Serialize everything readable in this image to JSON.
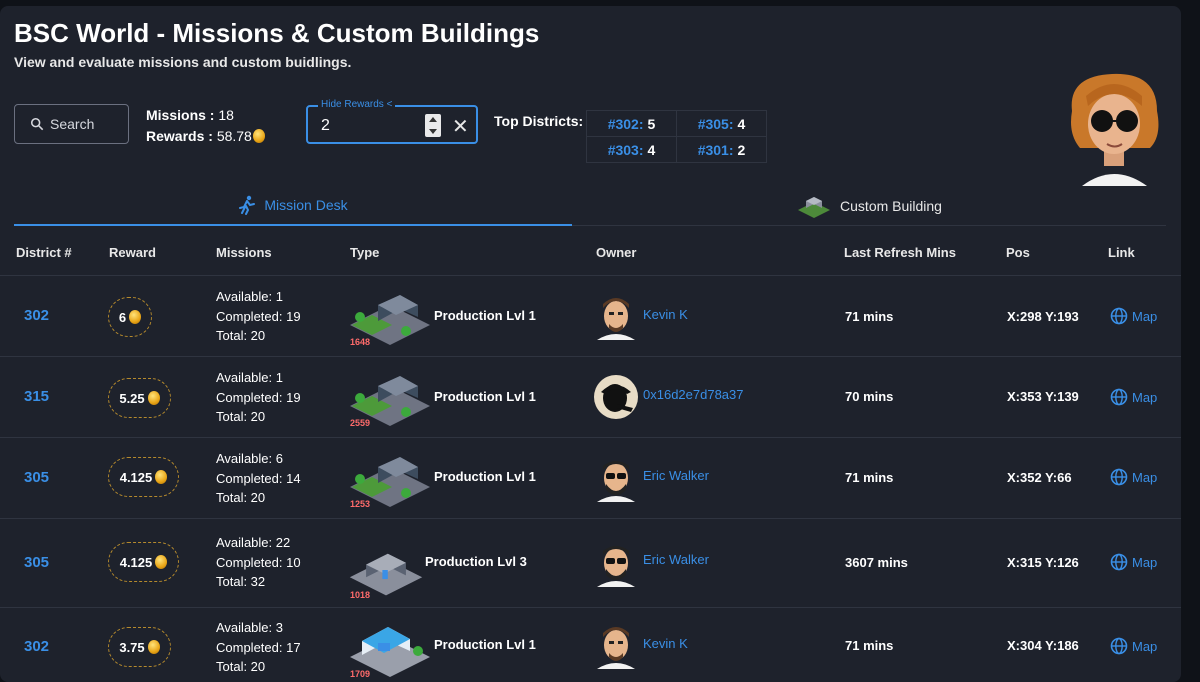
{
  "header": {
    "title": "BSC World - Missions & Custom Buildings",
    "subtitle": "View and evaluate missions and custom buidlings."
  },
  "toolbar": {
    "search_label": "Search",
    "missions_label": "Missions :",
    "missions_value": "18",
    "rewards_label": "Rewards :",
    "rewards_value": "58.78",
    "hide_rewards_label": "Hide Rewards <",
    "hide_rewards_value": "2",
    "top_districts_label": "Top Districts:"
  },
  "top_districts": [
    {
      "district": "#302:",
      "count": "5"
    },
    {
      "district": "#305:",
      "count": "4"
    },
    {
      "district": "#303:",
      "count": "4"
    },
    {
      "district": "#301:",
      "count": "2"
    }
  ],
  "tabs": [
    {
      "label": "Mission Desk",
      "active": true
    },
    {
      "label": "Custom Building",
      "active": false
    }
  ],
  "table": {
    "headers": [
      "District #",
      "Reward",
      "Missions",
      "Type",
      "Owner",
      "Last Refresh Mins",
      "Pos",
      "Link"
    ],
    "rows": [
      {
        "district": "302",
        "reward": "6",
        "available": "Available: 1",
        "completed": "Completed: 19",
        "total": "Total: 20",
        "type": "Production Lvl 1",
        "type_code": "1648",
        "owner": "Kevin K",
        "refresh": "71 mins",
        "pos": "X:298 Y:193",
        "link": "Map"
      },
      {
        "district": "315",
        "reward": "5.25",
        "available": "Available: 1",
        "completed": "Completed: 19",
        "total": "Total: 20",
        "type": "Production Lvl 1",
        "type_code": "2559",
        "owner": "0x16d2e7d78a37",
        "refresh": "70 mins",
        "pos": "X:353 Y:139",
        "link": "Map"
      },
      {
        "district": "305",
        "reward": "4.125",
        "available": "Available: 6",
        "completed": "Completed: 14",
        "total": "Total: 20",
        "type": "Production Lvl 1",
        "type_code": "1253",
        "owner": "Eric Walker",
        "refresh": "71 mins",
        "pos": "X:352 Y:66",
        "link": "Map"
      },
      {
        "district": "305",
        "reward": "4.125",
        "available": "Available: 22",
        "completed": "Completed: 10",
        "total": "Total: 32",
        "type": "Production Lvl 3",
        "type_code": "1018",
        "owner": "Eric Walker",
        "refresh": "3607 mins",
        "pos": "X:315 Y:126",
        "link": "Map"
      },
      {
        "district": "302",
        "reward": "3.75",
        "available": "Available: 3",
        "completed": "Completed: 17",
        "total": "Total: 20",
        "type": "Production Lvl 1",
        "type_code": "1709",
        "owner": "Kevin K",
        "refresh": "71 mins",
        "pos": "X:304 Y:186",
        "link": "Map"
      }
    ]
  },
  "colors": {
    "accent": "#3a8fe6",
    "background": "#1e222c",
    "coin": "#e8a415",
    "code": "#ff6b6b"
  }
}
